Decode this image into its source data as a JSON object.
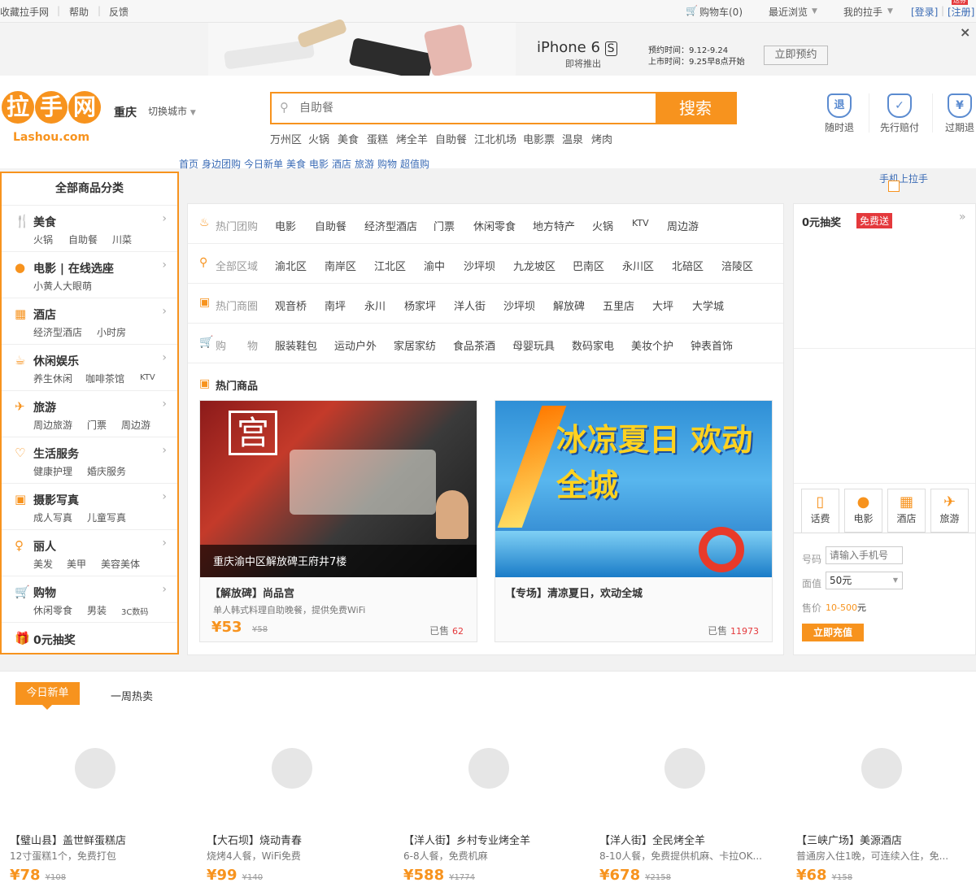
{
  "topbar": {
    "favorite": "收藏拉手网",
    "help": "帮助",
    "feedback": "反馈",
    "cart": "购物车(0)",
    "recent": "最近浏览",
    "mine": "我的拉手",
    "login": "[登录]",
    "register": "[注册]",
    "reg_badge": "送券"
  },
  "banner": {
    "phone_brand": "iPhone 6",
    "phone_model": "S",
    "coming": "即将推出",
    "preorder_time": "预约时间：9.12-9.24",
    "release_time": "上市时间：9.25早8点开始",
    "preorder_btn": "立即预约",
    "close": "×"
  },
  "header": {
    "logo_text": "拉手网",
    "logo_domain": "Lashou.com",
    "city": "重庆",
    "switch_city": "切换城市",
    "search_placeholder": "自助餐",
    "search_btn": "搜索",
    "hotwords": [
      "万州区",
      "火锅",
      "美食",
      "蛋糕",
      "烤全羊",
      "自助餐",
      "江北机场",
      "电影票",
      "温泉",
      "烤肉"
    ],
    "guarantees": [
      {
        "icon": "退",
        "label": "随时退"
      },
      {
        "icon": "✓",
        "label": "先行赔付"
      },
      {
        "icon": "¥",
        "label": "过期退"
      }
    ],
    "mobile": "手机上拉手"
  },
  "nav": [
    "首页",
    "身边团购",
    "今日新单",
    "美食",
    "电影",
    "酒店",
    "旅游",
    "购物",
    "超值购"
  ],
  "categories": {
    "title": "全部商品分类",
    "items": [
      {
        "icon": "utensils-icon",
        "glyph": "🍴",
        "name": "美食",
        "subs": [
          "火锅",
          "自助餐",
          "川菜"
        ]
      },
      {
        "icon": "film-icon",
        "glyph": "●",
        "name": "电影 | 在线选座",
        "subs": [
          "小黄人大眼萌"
        ]
      },
      {
        "icon": "hotel-icon",
        "glyph": "▦",
        "name": "酒店",
        "subs": [
          "经济型酒店",
          "小时房"
        ]
      },
      {
        "icon": "coffee-icon",
        "glyph": "☕",
        "name": "休闲娱乐",
        "subs": [
          "养生休闲",
          "咖啡茶馆",
          "KTV"
        ]
      },
      {
        "icon": "plane-icon",
        "glyph": "✈",
        "name": "旅游",
        "subs": [
          "周边旅游",
          "门票",
          "周边游"
        ]
      },
      {
        "icon": "heart-icon",
        "glyph": "♡",
        "name": "生活服务",
        "subs": [
          "健康护理",
          "婚庆服务"
        ]
      },
      {
        "icon": "photo-icon",
        "glyph": "▣",
        "name": "摄影写真",
        "subs": [
          "成人写真",
          "儿童写真"
        ]
      },
      {
        "icon": "beauty-icon",
        "glyph": "♀",
        "name": "丽人",
        "subs": [
          "美发",
          "美甲",
          "美容美体"
        ]
      },
      {
        "icon": "cart-icon",
        "glyph": "🛒",
        "name": "购物",
        "subs": [
          "休闲零食",
          "男装",
          "3C数码"
        ]
      }
    ],
    "lottery": "0元抽奖"
  },
  "filters": [
    {
      "label": "热门团购",
      "items": [
        "电影",
        "自助餐",
        "经济型酒店",
        "门票",
        "休闲零食",
        "地方特产",
        "火锅",
        "KTV",
        "周边游"
      ]
    },
    {
      "label": "全部区域",
      "items": [
        "渝北区",
        "南岸区",
        "江北区",
        "渝中",
        "沙坪坝",
        "九龙坡区",
        "巴南区",
        "永川区",
        "北碚区",
        "涪陵区"
      ]
    },
    {
      "label": "热门商圈",
      "items": [
        "观音桥",
        "南坪",
        "永川",
        "杨家坪",
        "洋人街",
        "沙坪坝",
        "解放碑",
        "五里店",
        "大坪",
        "大学城"
      ]
    },
    {
      "label": "购　　物",
      "items": [
        "服装鞋包",
        "运动户外",
        "家居家纺",
        "食品茶酒",
        "母婴玩具",
        "数码家电",
        "美妆个护",
        "钟表首饰"
      ]
    }
  ],
  "hot": {
    "title": "热门商品",
    "cards": [
      {
        "overlay": "重庆渝中区解放碑王府井7楼",
        "name": "【解放碑】尚品宫",
        "desc": "单人韩式料理自助晚餐，提供免费WiFi",
        "price": "53",
        "orig": "58",
        "sold_label": "已售",
        "sold": "62",
        "img_text": "宫"
      },
      {
        "overlay": "",
        "name": "【专场】清凉夏日，欢动全城",
        "desc": "",
        "price": "",
        "orig": "",
        "sold_label": "已售",
        "sold": "11973",
        "img_text": "冰凉夏日 欢动全城"
      }
    ]
  },
  "right": {
    "lottery_title": "0元抽奖",
    "lottery_badge": "免费送",
    "tools": [
      {
        "icon": "phone-icon",
        "glyph": "▯",
        "label": "话费"
      },
      {
        "icon": "film-icon",
        "glyph": "●",
        "label": "电影"
      },
      {
        "icon": "hotel-icon",
        "glyph": "▦",
        "label": "酒店"
      },
      {
        "icon": "plane-icon",
        "glyph": "✈",
        "label": "旅游"
      }
    ],
    "phone_label": "号码",
    "phone_placeholder": "请输入手机号",
    "face_label": "面值",
    "face_value": "50元",
    "price_label": "售价",
    "price_value": "10-500",
    "price_unit": "元",
    "recharge_btn": "立即充值"
  },
  "tabs": {
    "today": "今日新单",
    "week": "一周热卖"
  },
  "products": [
    {
      "name": "【璧山县】盖世鲜蛋糕店",
      "desc": "12寸蛋糕1个，免费打包",
      "price": "78",
      "orig": "108"
    },
    {
      "name": "【大石坝】烧动青春",
      "desc": "烧烤4人餐，WiFi免费",
      "price": "99",
      "orig": "140"
    },
    {
      "name": "【洋人街】乡村专业烤全羊",
      "desc": "6-8人餐，免费机麻",
      "price": "588",
      "orig": "1774"
    },
    {
      "name": "【洋人街】全民烤全羊",
      "desc": "8-10人餐，免费提供机麻、卡拉OK...",
      "price": "678",
      "orig": "2158"
    },
    {
      "name": "【三峡广场】美源酒店",
      "desc": "普通房入住1晚，可连续入住，免...",
      "price": "68",
      "orig": "158"
    }
  ]
}
